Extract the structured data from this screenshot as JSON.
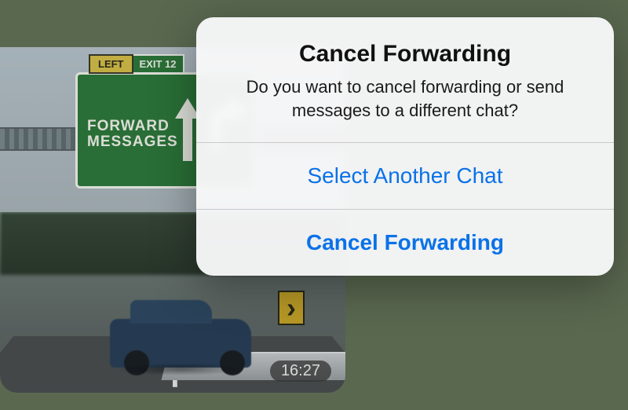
{
  "message": {
    "sign": {
      "left_label": "LEFT",
      "exit_label": "EXIT",
      "exit_number": "12",
      "line1": "FORWARD",
      "line2": "MESSAGES"
    },
    "timestamp": "16:27"
  },
  "alert": {
    "title": "Cancel Forwarding",
    "message": "Do you want to cancel forwarding or send messages to a different chat?",
    "select_label": "Select Another Chat",
    "cancel_label": "Cancel Forwarding"
  },
  "colors": {
    "accent": "#0a72e8",
    "sign_green": "#2e7a3c"
  }
}
